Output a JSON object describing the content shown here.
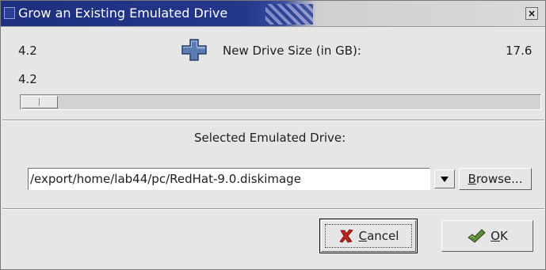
{
  "window": {
    "title": "Grow an Existing Emulated Drive",
    "close_glyph": "×"
  },
  "size": {
    "current_value_top": "4.2",
    "current_value_bottom": "4.2",
    "new_size_label": "New Drive Size (in GB):",
    "max_value": "17.6",
    "slider_fraction": 0.0
  },
  "drive": {
    "selected_label": "Selected Emulated Drive:",
    "path_value": "/export/home/lab44/pc/RedHat-9.0.diskimage"
  },
  "buttons": {
    "browse_mnemonic": "B",
    "browse_rest": "rowse...",
    "cancel_mnemonic": "C",
    "cancel_rest": "ancel",
    "ok_mnemonic": "O",
    "ok_rest": "K"
  },
  "icons": {
    "title": "app-window-icon",
    "plus": "plus-icon",
    "cancel": "red-x-icon",
    "ok": "green-check-icon"
  },
  "colors": {
    "title_bar": "#1d2f7e",
    "window_bg": "#e6e6e6",
    "plus_fill": "#5a7bb0",
    "cancel_icon": "#c0231b",
    "ok_icon": "#5c8a3a"
  }
}
